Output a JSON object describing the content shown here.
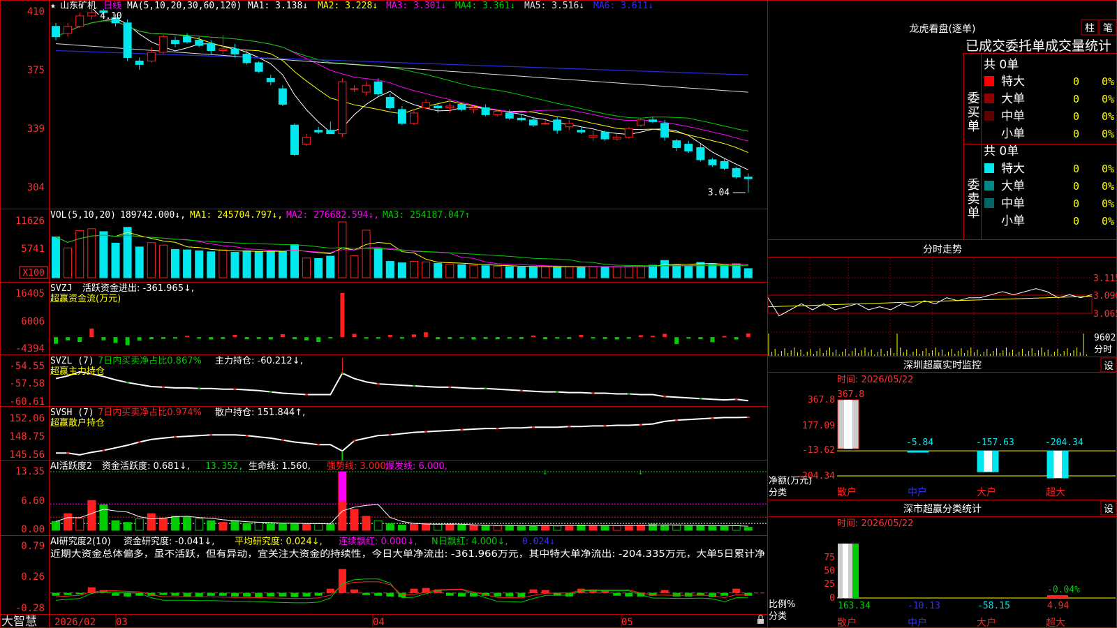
{
  "colors": {
    "frame": "#c00000",
    "up": "#ff2020",
    "down": "#00e8ee",
    "green": "#00cc00",
    "yellow": "#ffff00",
    "magenta": "#ff00ff",
    "axis_text": "#ff3030",
    "white": "#ffffff",
    "blue": "#2020c0"
  },
  "main": {
    "star": "★",
    "stock": "山东矿机",
    "period": "日线",
    "ma_prefix": "MA(5,10,20,30,60,120)",
    "ma1": "MA1: 3.138↓",
    "ma2": "MA2: 3.228↓",
    "ma3": "MA3: 3.301↓",
    "ma4": "MA4: 3.361↓",
    "ma5": "MA5: 3.516↓",
    "ma6": "MA6: 3.611↓",
    "y_ticks": [
      "410",
      "375",
      "339",
      "304"
    ],
    "hi_label": "4.10",
    "lo_label": "3.04"
  },
  "vol": {
    "label": "VOL(5,10,20)",
    "value": "189742.000↓,",
    "ma1": "MA1: 245704.797↓,",
    "ma2": "MA2: 276682.594↓,",
    "ma3": "MA3: 254187.047↑",
    "y_ticks": [
      "11626",
      "5741"
    ],
    "unit": "X100"
  },
  "svzj": {
    "label": "SVZJ",
    "text": "活跃资金进出: -361.965↓,",
    "sub": "超赢资金流(万元)",
    "y_ticks": [
      "16405",
      "6006",
      "-4394"
    ]
  },
  "svzl": {
    "label": "SVZL (7)",
    "ratio": "7日内买卖净占比0.867%",
    "hold": "主力持仓: -60.212↓,",
    "sub": "超赢主力持仓",
    "y_ticks": [
      "-54.55",
      "-57.58",
      "-60.61"
    ]
  },
  "svsh": {
    "label": "SVSH (7)",
    "ratio": "7日内买卖净占比0.974%",
    "hold": "散户持仓: 151.844↑,",
    "sub": "超赢散户持仓",
    "y_ticks": [
      "152.06",
      "148.75",
      "145.56"
    ]
  },
  "ai1": {
    "label": "AI活跃度2",
    "act": "资金活跃度: 0.681↓,",
    "v2": "13.352,",
    "life": "生命线: 1.560,",
    "strong": "强势线: 3.000,",
    "burst": "爆发线: 6.000,",
    "y_ticks": [
      "13.35",
      "6.60",
      "0.00"
    ]
  },
  "ai2": {
    "label": "AI研究度2(10)",
    "res": "资金研究度: -0.041↓,",
    "avg": "平均研究度: 0.024↓,",
    "cont": "连续飘红: 0.000↓,",
    "n": "N日飘红: 4.000↓,",
    "last": "0.024↓",
    "note": "近期大资金总体偏多，虽不活跃，但有异动，宜关注大资金的持续性，今日大单净流出: -361.966万元，其中特大单净流出: -204.335万元，大单5日累计净",
    "y_ticks": [
      "0.79",
      "0.26",
      "-0.28"
    ]
  },
  "bottom": {
    "brand": "大智慧",
    "dates": [
      "2026/02",
      "03",
      "04",
      "05"
    ]
  },
  "right": {
    "lhb_title": "龙虎看盘(逐单)",
    "btn_zhu": "柱",
    "btn_bi": "笔",
    "stat_title": "已成交委托单成交量统计",
    "buy_head": "委买单",
    "sell_head": "委卖单",
    "buy_total": "共 0单",
    "sell_total": "共 0单",
    "buy_rows": [
      {
        "name": "特大",
        "count": "0",
        "pct": "0%",
        "color": "#ff0000"
      },
      {
        "name": "大单",
        "count": "0",
        "pct": "0%",
        "color": "#900000"
      },
      {
        "name": "中单",
        "count": "0",
        "pct": "0%",
        "color": "#600000"
      },
      {
        "name": "小单",
        "count": "0",
        "pct": "0%",
        "color": "#000000"
      }
    ],
    "sell_rows": [
      {
        "name": "特大",
        "count": "0",
        "pct": "0%",
        "color": "#00e8ee"
      },
      {
        "name": "大单",
        "count": "0",
        "pct": "0%",
        "color": "#008888"
      },
      {
        "name": "中单",
        "count": "0",
        "pct": "0%",
        "color": "#006666"
      },
      {
        "name": "小单",
        "count": "0",
        "pct": "0%",
        "color": "#000000"
      }
    ],
    "intraday_title": "分时走势",
    "intraday_ticks": [
      "3.115",
      "3.090",
      "3.065"
    ],
    "intraday_vol": "9602",
    "intraday_unit": "分时",
    "monitor_title": "深圳超赢实时监控",
    "settings": "设",
    "monitor_time": "时间: 2026/05/22",
    "monitor_ticks": [
      "367.8",
      "177.09",
      "-13.62",
      "-204.34"
    ],
    "monitor_unit": "净额(万元)",
    "monitor_cat": "分类",
    "categories": [
      "散户",
      "中户",
      "大户",
      "超大"
    ],
    "monitor_values": [
      "367.8",
      "-5.84",
      "-157.63",
      "-204.34"
    ],
    "class_title": "深市超赢分类统计",
    "class_time": "时间: 2026/05/22",
    "class_ticks": [
      "75",
      "50",
      "25",
      "0"
    ],
    "class_unit": "比例%",
    "class_cat": "分类",
    "class_values": [
      "163.34",
      "-10.13",
      "-58.15",
      "4.94"
    ],
    "class_small": "-0.04%"
  },
  "chart_data": [
    {
      "type": "candlestick",
      "title": "山东矿机 日线",
      "ylim": [
        3.0,
        4.12
      ],
      "hi": 4.1,
      "lo": 3.04,
      "ohlc": [
        [
          4.0,
          4.02,
          3.92,
          3.94
        ],
        [
          3.96,
          4.02,
          3.94,
          4.0
        ],
        [
          4.0,
          4.08,
          3.99,
          4.06
        ],
        [
          4.06,
          4.1,
          4.04,
          4.08
        ],
        [
          4.09,
          4.1,
          4.07,
          4.08
        ],
        [
          4.05,
          4.07,
          4.0,
          4.02
        ],
        [
          4.02,
          4.04,
          3.8,
          3.82
        ],
        [
          3.8,
          3.82,
          3.75,
          3.78
        ],
        [
          3.8,
          3.88,
          3.79,
          3.85
        ],
        [
          3.85,
          3.96,
          3.84,
          3.94
        ],
        [
          3.92,
          3.94,
          3.88,
          3.9
        ],
        [
          3.94,
          3.96,
          3.9,
          3.91
        ],
        [
          3.92,
          3.94,
          3.88,
          3.89
        ],
        [
          3.9,
          3.92,
          3.84,
          3.86
        ],
        [
          3.86,
          3.95,
          3.84,
          3.87
        ],
        [
          3.87,
          3.9,
          3.82,
          3.84
        ],
        [
          3.84,
          3.86,
          3.78,
          3.79
        ],
        [
          3.79,
          3.8,
          3.73,
          3.74
        ],
        [
          3.7,
          3.72,
          3.66,
          3.68
        ],
        [
          3.64,
          3.66,
          3.54,
          3.55
        ],
        [
          3.43,
          3.44,
          3.25,
          3.26
        ],
        [
          3.32,
          3.38,
          3.31,
          3.36
        ],
        [
          3.4,
          3.42,
          3.38,
          3.39
        ],
        [
          3.4,
          3.45,
          3.38,
          3.38
        ],
        [
          3.38,
          3.7,
          3.36,
          3.68
        ],
        [
          3.64,
          3.66,
          3.62,
          3.64
        ],
        [
          3.62,
          3.68,
          3.6,
          3.66
        ],
        [
          3.68,
          3.7,
          3.6,
          3.61
        ],
        [
          3.59,
          3.61,
          3.52,
          3.53
        ],
        [
          3.52,
          3.54,
          3.43,
          3.44
        ],
        [
          3.44,
          3.52,
          3.43,
          3.5
        ],
        [
          3.53,
          3.58,
          3.52,
          3.56
        ],
        [
          3.54,
          3.56,
          3.5,
          3.53
        ],
        [
          3.53,
          3.56,
          3.5,
          3.54
        ],
        [
          3.55,
          3.56,
          3.51,
          3.52
        ],
        [
          3.52,
          3.54,
          3.5,
          3.53
        ],
        [
          3.53,
          3.55,
          3.48,
          3.49
        ],
        [
          3.49,
          3.52,
          3.48,
          3.51
        ],
        [
          3.5,
          3.52,
          3.46,
          3.47
        ],
        [
          3.47,
          3.49,
          3.45,
          3.46
        ],
        [
          3.46,
          3.48,
          3.42,
          3.43
        ],
        [
          3.44,
          3.46,
          3.43,
          3.44
        ],
        [
          3.46,
          3.48,
          3.38,
          3.4
        ],
        [
          3.42,
          3.46,
          3.4,
          3.44
        ],
        [
          3.4,
          3.42,
          3.38,
          3.39
        ],
        [
          3.36,
          3.4,
          3.34,
          3.37
        ],
        [
          3.39,
          3.4,
          3.34,
          3.35
        ],
        [
          3.35,
          3.38,
          3.34,
          3.36
        ],
        [
          3.36,
          3.42,
          3.35,
          3.41
        ],
        [
          3.43,
          3.47,
          3.42,
          3.46
        ],
        [
          3.46,
          3.48,
          3.44,
          3.45
        ],
        [
          3.44,
          3.46,
          3.34,
          3.36
        ],
        [
          3.34,
          3.35,
          3.28,
          3.3
        ],
        [
          3.32,
          3.34,
          3.27,
          3.28
        ],
        [
          3.3,
          3.32,
          3.22,
          3.23
        ],
        [
          3.23,
          3.24,
          3.19,
          3.2
        ],
        [
          3.22,
          3.24,
          3.17,
          3.18
        ],
        [
          3.18,
          3.19,
          3.12,
          3.13
        ],
        [
          3.13,
          3.15,
          3.04,
          3.12
        ]
      ]
    },
    {
      "type": "bar",
      "title": "VOL(5,10,20)",
      "unit": "X100",
      "ylim": [
        0,
        11626
      ],
      "values": [
        8500,
        6200,
        9800,
        10200,
        9600,
        7200,
        10500,
        6400,
        7300,
        6800,
        5900,
        5800,
        5600,
        5400,
        5800,
        5300,
        5600,
        5400,
        5500,
        5600,
        6900,
        4100,
        4000,
        4500,
        11626,
        4600,
        9900,
        6100,
        3400,
        3100,
        3400,
        3300,
        3000,
        2800,
        2700,
        2600,
        2500,
        2400,
        2300,
        2200,
        2300,
        2300,
        2300,
        2300,
        2300,
        2400,
        2300,
        2300,
        2400,
        2500,
        2600,
        3600,
        2700,
        2500,
        3200,
        2900,
        2700,
        2900,
        1899
      ]
    },
    {
      "type": "bar",
      "title": "超赢资金流(万元)",
      "ylim": [
        -4394,
        16405
      ],
      "values": [
        -2500,
        -1200,
        -1800,
        3200,
        -1200,
        -2200,
        -3000,
        -1300,
        -800,
        -700,
        -600,
        500,
        -600,
        -900,
        -700,
        800,
        -800,
        -700,
        -900,
        1100,
        -800,
        -1200,
        -1800,
        -500,
        16405,
        1200,
        -600,
        -600,
        800,
        -600,
        1000,
        1800,
        -800,
        -700,
        -600,
        -900,
        -700,
        -800,
        -600,
        -700,
        600,
        -800,
        -600,
        -700,
        800,
        -500,
        -700,
        -900,
        -600,
        700,
        500,
        1200,
        -2600,
        -600,
        -800,
        -1900,
        400,
        -900,
        1361
      ]
    },
    {
      "type": "line",
      "title": "超赢主力持仓",
      "ylim": [
        -60.61,
        -54.55
      ],
      "values": [
        -56.9,
        -56.5,
        -55.9,
        -56.2,
        -56.6,
        -57.1,
        -57.5,
        -57.8,
        -58.1,
        -58.2,
        -58.3,
        -58.3,
        -58.4,
        -58.4,
        -58.5,
        -58.5,
        -58.6,
        -58.7,
        -58.9,
        -59.1,
        -59.2,
        -59.3,
        -59.3,
        -59.3,
        -56.1,
        -56.9,
        -57.4,
        -57.7,
        -57.8,
        -57.9,
        -58.0,
        -58.1,
        -58.2,
        -58.2,
        -58.3,
        -58.4,
        -58.4,
        -58.5,
        -58.6,
        -58.7,
        -58.8,
        -58.9,
        -58.9,
        -59.0,
        -59.0,
        -59.1,
        -59.1,
        -59.2,
        -59.2,
        -59.3,
        -59.3,
        -59.6,
        -59.7,
        -59.8,
        -59.9,
        -60.0,
        -60.1,
        -60.0,
        -60.212
      ]
    },
    {
      "type": "line",
      "title": "超赢散户持仓",
      "ylim": [
        145.56,
        152.06
      ],
      "values": [
        146.3,
        146.3,
        146.0,
        146.4,
        146.7,
        147.1,
        147.5,
        148.0,
        148.4,
        148.6,
        148.8,
        148.9,
        149.0,
        149.1,
        149.1,
        149.1,
        149.0,
        148.8,
        148.6,
        148.3,
        148.0,
        147.8,
        147.6,
        147.6,
        146.6,
        148.2,
        148.6,
        149.0,
        149.1,
        149.3,
        149.5,
        149.6,
        149.7,
        149.8,
        149.9,
        150.0,
        150.1,
        150.1,
        150.2,
        150.2,
        150.3,
        150.3,
        150.3,
        150.4,
        150.4,
        150.5,
        150.5,
        150.6,
        150.6,
        150.7,
        150.8,
        151.2,
        151.4,
        151.5,
        151.6,
        151.7,
        151.8,
        151.8,
        151.844
      ]
    },
    {
      "type": "bar",
      "title": "AI活跃度2",
      "ylim": [
        0,
        13.35
      ],
      "values": [
        2.0,
        3.8,
        2.8,
        6.8,
        5.8,
        2.2,
        1.8,
        2.6,
        3.8,
        2.8,
        3.2,
        3.0,
        2.6,
        2.2,
        1.8,
        2.2,
        1.6,
        1.8,
        1.5,
        1.6,
        1.6,
        1.4,
        1.5,
        1.4,
        13.35,
        4.8,
        3.2,
        2.2,
        1.5,
        1.2,
        1.4,
        1.6,
        1.4,
        1.3,
        1.2,
        1.1,
        1.1,
        1.0,
        1.1,
        1.0,
        1.0,
        1.1,
        1.0,
        1.1,
        1.2,
        1.1,
        1.0,
        1.0,
        1.1,
        1.2,
        1.4,
        1.2,
        1.1,
        1.0,
        1.1,
        1.0,
        1.0,
        1.1,
        0.681
      ]
    },
    {
      "type": "bar",
      "title": "AI研究度2(10)",
      "ylim": [
        -0.28,
        0.79
      ],
      "values": [
        -0.04,
        -0.03,
        -0.02,
        0.08,
        0.04,
        -0.04,
        -0.05,
        -0.04,
        -0.04,
        -0.03,
        -0.04,
        -0.05,
        -0.05,
        -0.04,
        -0.04,
        -0.05,
        -0.05,
        -0.06,
        -0.05,
        -0.05,
        -0.06,
        -0.05,
        -0.04,
        0.06,
        0.34,
        0.05,
        -0.03,
        -0.04,
        -0.05,
        -0.06,
        0.06,
        0.07,
        0.05,
        -0.04,
        -0.05,
        -0.05,
        -0.04,
        -0.05,
        -0.05,
        -0.06,
        0.05,
        0.04,
        -0.04,
        -0.05,
        0.06,
        0.05,
        0.04,
        -0.04,
        -0.05,
        -0.05,
        -0.04,
        0.04,
        -0.05,
        -0.05,
        -0.04,
        -0.06,
        -0.04,
        0.06,
        -0.041
      ]
    },
    {
      "type": "line",
      "title": "分时走势",
      "ylim": [
        3.04,
        3.13
      ],
      "values": [
        3.09,
        3.06,
        3.07,
        3.08,
        3.07,
        3.08,
        3.07,
        3.075,
        3.08,
        3.07,
        3.075,
        3.07,
        3.08,
        3.075,
        3.085,
        3.08,
        3.09,
        3.085,
        3.09,
        3.09,
        3.095,
        3.1,
        3.095,
        3.1,
        3.105,
        3.1,
        3.09,
        3.095,
        3.09,
        3.095
      ]
    },
    {
      "type": "bar",
      "title": "深圳超赢实时监控",
      "categories": [
        "散户",
        "中户",
        "大户",
        "超大"
      ],
      "values": [
        367.8,
        -5.84,
        -157.63,
        -204.34
      ],
      "ylim": [
        -204.34,
        367.8
      ]
    },
    {
      "type": "bar",
      "title": "深市超赢分类统计",
      "categories": [
        "散户",
        "中户",
        "大户",
        "超大"
      ],
      "values": [
        163.34,
        -10.13,
        -58.15,
        4.94
      ],
      "ylim": [
        0,
        75
      ]
    }
  ]
}
